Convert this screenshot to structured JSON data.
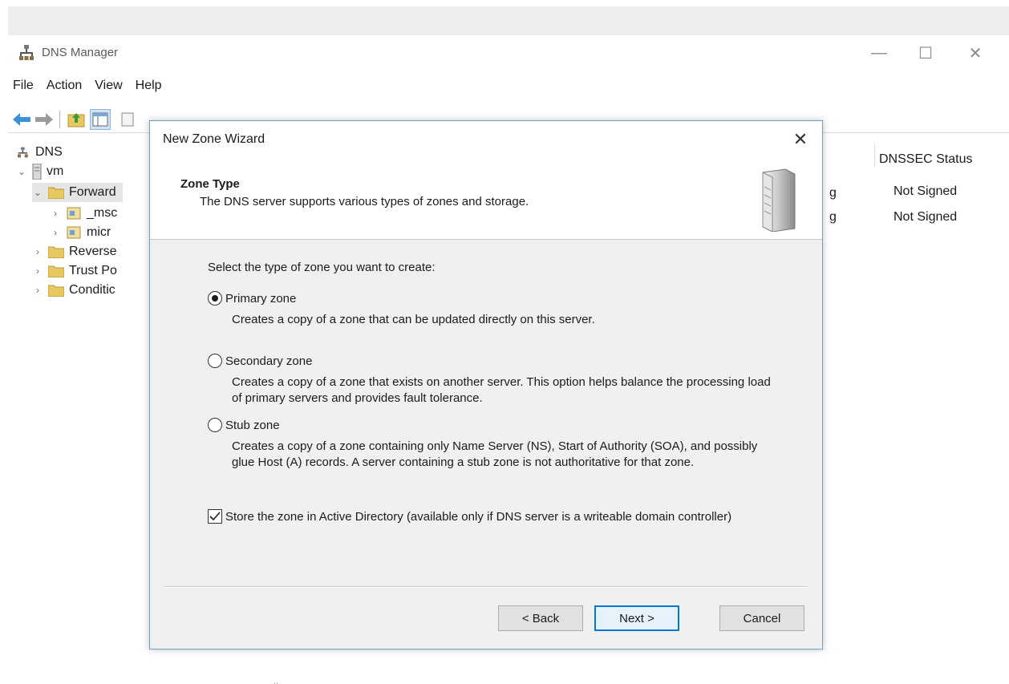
{
  "window": {
    "title": "DNS Manager",
    "controls": {
      "minimize": "—",
      "maximize": "☐",
      "close": "✕"
    }
  },
  "menu": [
    "File",
    "Action",
    "View",
    "Help"
  ],
  "tree": {
    "root": "DNS",
    "server": "vm",
    "forward": "Forward",
    "child1": "_msc",
    "child2": "micr",
    "reverse": "Reverse",
    "trust": "Trust Po",
    "conditional": "Conditic"
  },
  "list": {
    "header": "DNSSEC Status",
    "rows": [
      "Not Signed",
      "Not Signed"
    ],
    "fragments": [
      "g",
      "g"
    ]
  },
  "dialog": {
    "title": "New Zone Wizard",
    "close": "✕",
    "header_title": "Zone Type",
    "header_subtitle": "The DNS server supports various types of zones and storage.",
    "prompt": "Select the type of zone you want to create:",
    "options": [
      {
        "label": "Primary zone",
        "selected": true,
        "description": "Creates a copy of a zone that can be updated directly on this server."
      },
      {
        "label": "Secondary zone",
        "selected": false,
        "description": "Creates a copy of a zone that exists on another server. This option helps balance the processing load of primary servers and provides fault tolerance."
      },
      {
        "label": "Stub zone",
        "selected": false,
        "description": "Creates a copy of a zone containing only Name Server (NS), Start of Authority (SOA), and possibly glue Host (A) records. A server containing a stub zone is not authoritative for that zone."
      }
    ],
    "store_ad": {
      "checked": true,
      "label": "Store the zone in Active Directory (available only if DNS server is a writeable domain controller)"
    },
    "buttons": {
      "back": "< Back",
      "next": "Next >",
      "cancel": "Cancel"
    }
  },
  "colors": {
    "dialog_border": "#6f9fcf",
    "default_button_border": "#0078d7",
    "folder": "#e8c860"
  }
}
